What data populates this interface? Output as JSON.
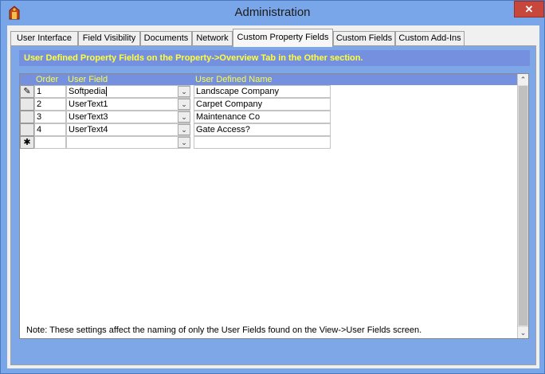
{
  "window": {
    "title": "Administration",
    "close_label": "✕"
  },
  "tabs": [
    {
      "label": "User Interface",
      "active": false
    },
    {
      "label": "Field Visibility",
      "active": false
    },
    {
      "label": "Documents",
      "active": false
    },
    {
      "label": "Network",
      "active": false
    },
    {
      "label": "Custom Property Fields",
      "active": true
    },
    {
      "label": "Custom Fields",
      "active": false
    },
    {
      "label": "Custom Add-Ins",
      "active": false
    }
  ],
  "banner": "User Defined Property Fields on the Property->Overview Tab in the Other section.",
  "grid": {
    "columns": [
      "Order",
      "User Field",
      "User Defined Name"
    ],
    "rows": [
      {
        "selector": "✎",
        "order": "1",
        "user_field": "Softpedia",
        "name": "Landscape Company"
      },
      {
        "selector": "",
        "order": "2",
        "user_field": "UserText1",
        "name": "Carpet Company"
      },
      {
        "selector": "",
        "order": "3",
        "user_field": "UserText3",
        "name": "Maintenance Co"
      },
      {
        "selector": "",
        "order": "4",
        "user_field": "UserText4",
        "name": "Gate Access?"
      },
      {
        "selector": "✱",
        "order": "",
        "user_field": "",
        "name": ""
      }
    ]
  },
  "note": "Note:  These settings affect the naming of only the User Fields found on the View->User Fields screen."
}
